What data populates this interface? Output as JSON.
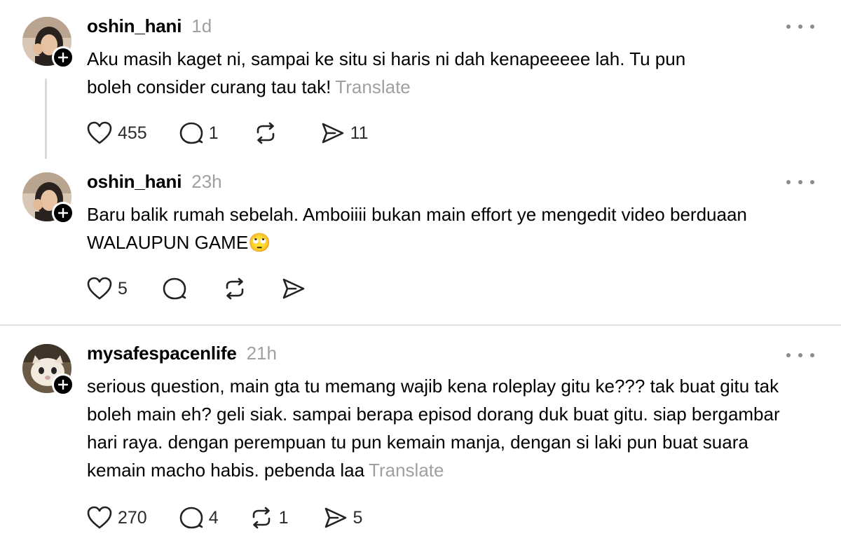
{
  "posts": [
    {
      "username": "oshin_hani",
      "time": "1d",
      "text": "Aku masih kaget ni, sampai ke situ si haris ni dah kenapeeeee lah. Tu pun boleh consider curang tau tak!",
      "translate": "Translate",
      "likes": "455",
      "replies": "1",
      "reposts": "",
      "shares": "11"
    },
    {
      "username": "oshin_hani",
      "time": "23h",
      "text": "Baru balik rumah sebelah. Amboiiii bukan main effort ye mengedit video berduaan WALAUPUN GAME🙄",
      "translate": "",
      "likes": "5",
      "replies": "",
      "reposts": "",
      "shares": ""
    },
    {
      "username": "mysafespacenlife",
      "time": "21h",
      "text": "serious question, main gta tu memang wajib kena roleplay gitu ke??? tak buat gitu tak boleh main eh? geli siak. sampai berapa episod dorang duk buat gitu. siap bergambar hari raya. dengan perempuan tu pun kemain manja, dengan si laki pun buat suara kemain macho habis. pebenda laa",
      "translate": "Translate",
      "likes": "270",
      "replies": "4",
      "reposts": "1",
      "shares": "5"
    }
  ],
  "icons": {
    "like": "heart-icon",
    "reply": "speech-bubble-icon",
    "repost": "repost-arrows-icon",
    "share": "send-icon",
    "more": "more-horizontal-icon",
    "follow": "plus-icon"
  }
}
